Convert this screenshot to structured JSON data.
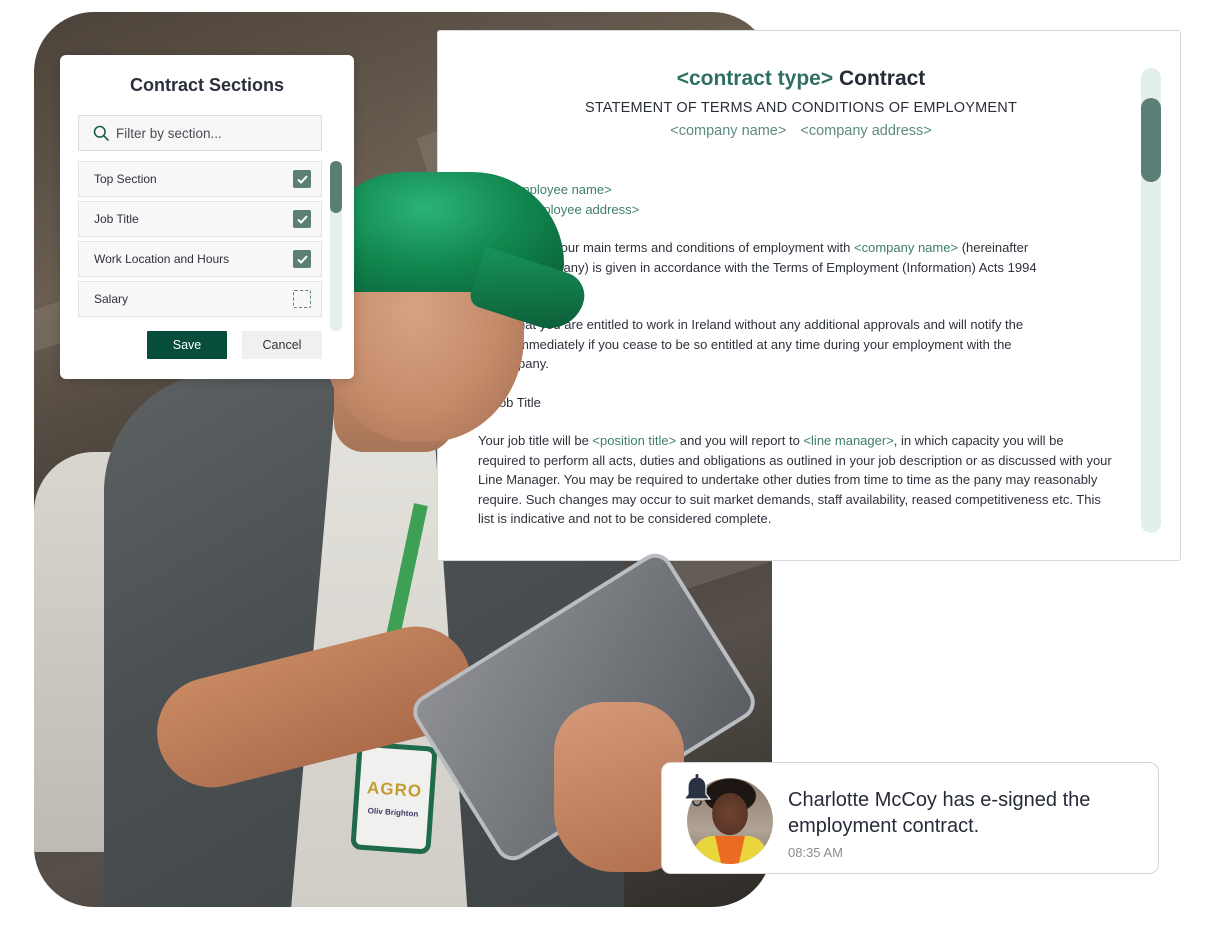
{
  "contract_sections": {
    "title": "Contract Sections",
    "filter": {
      "placeholder": "Filter by section...",
      "value": ""
    },
    "items": [
      {
        "label": "Top Section",
        "checked": true
      },
      {
        "label": "Job Title",
        "checked": true
      },
      {
        "label": "Work Location and Hours",
        "checked": true
      },
      {
        "label": "Salary",
        "checked": false
      }
    ],
    "save_label": "Save",
    "cancel_label": "Cancel"
  },
  "contract": {
    "title_placeholder": "<contract type>",
    "title_text": "Contract",
    "subtitle": "STATEMENT OF TERMS AND CONDITIONS OF EMPLOYMENT",
    "company_name": "<company name>",
    "company_address": "<company address>",
    "lines": {
      "employee_name_label": "",
      "employee_name": "<employee name>",
      "employee_address_label": "s:",
      "employee_address": "<employee address>",
      "para1_a": "ent of your main terms and conditions of employment with ",
      "para1_ph": "<company name>",
      "para1_b": " (hereinafter",
      "para1_c": "e Company) is given in accordance with the Terms of Employment (Information) Acts 1994",
      "para2_a": "hat you are entitled to work in Ireland without any additional approvals and will notify the",
      "para2_b": "mmediately if you cease to be so entitled at any time during your employment with the",
      "para2_c": "pany.",
      "section_heading": "1. Job Title",
      "para3_a": "Your job title will be ",
      "para3_ph1": "<position title>",
      "para3_b": " and you will report to ",
      "para3_ph2": "<line manager>",
      "para3_c": ", in which capacity you will be required to perform all acts, duties and obligations as outlined in your job description or as discussed with your Line Manager. You may be required to undertake other duties from time to time as the",
      "para3_d": "pany may reasonably require. Such changes may occur to suit market demands, staff availability,",
      "para3_e": "reased competitiveness etc. This list is indicative and not to be considered complete."
    }
  },
  "notification": {
    "icon": "bell-icon",
    "message": "Charlotte McCoy has e-signed the employment contract.",
    "time": "08:35 AM"
  },
  "photo": {
    "badge_logo": "AGRO",
    "badge_name": "Oliv Brighton"
  },
  "colors": {
    "accent_dark": "#064d3b",
    "accent": "#5b7f77",
    "placeholder_text": "#3f7d6f",
    "scroll_track": "#e2efed"
  }
}
